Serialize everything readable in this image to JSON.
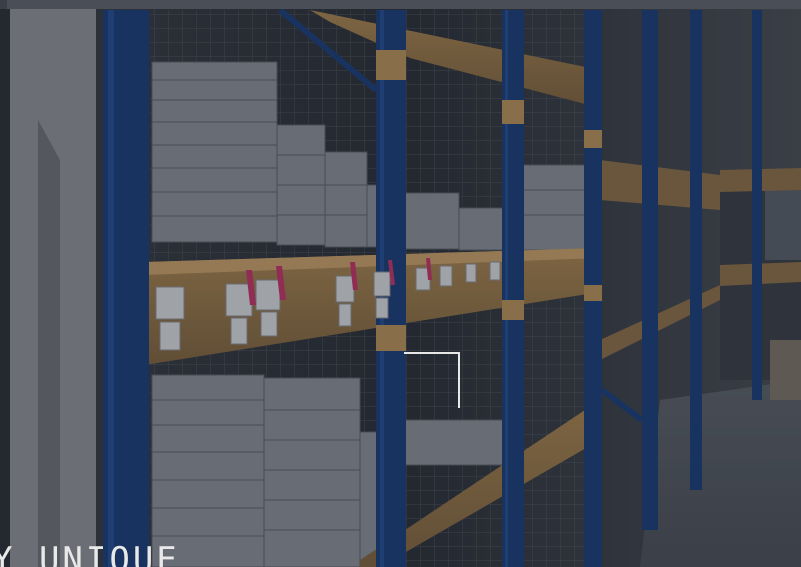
{
  "hero": {
    "tagline": "Y  UNIQUE",
    "image_subject": "warehouse-shelving"
  },
  "colors": {
    "overlay": "#12161e",
    "rack_blue": "#1c3f7a",
    "beam_orange": "#b8925a",
    "box_grey": "#8a8f98",
    "accent_white": "#e8e8e8",
    "label_pink": "#c2356a"
  }
}
